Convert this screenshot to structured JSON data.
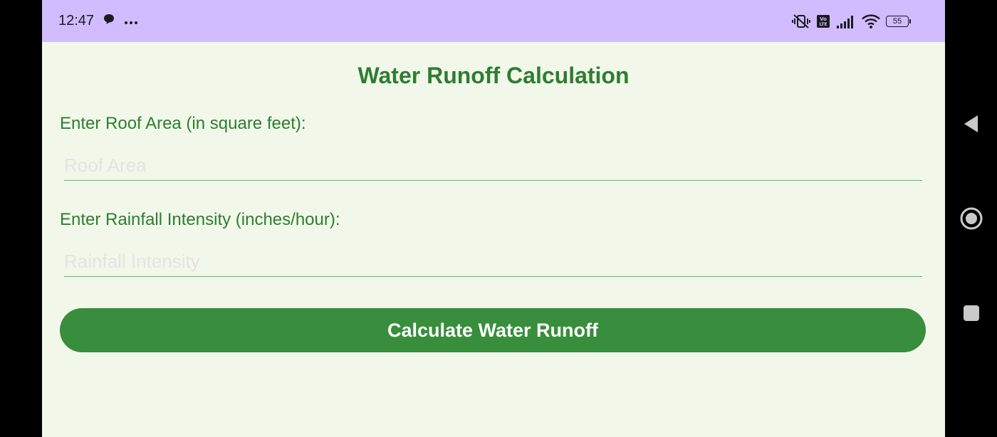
{
  "status_bar": {
    "time": "12:47",
    "icons": [
      "chat-bubble-icon",
      "more-dots-icon",
      "vibrate-off-icon",
      "volte-icon",
      "signal-icon",
      "wifi-icon",
      "battery-icon"
    ],
    "battery_level": "55",
    "volte_label_top": "Vo",
    "volte_label_bottom": "LTE"
  },
  "app": {
    "title": "Water Runoff Calculation",
    "roof_area": {
      "label": "Enter Roof Area (in square feet):",
      "placeholder": "Roof Area",
      "value": ""
    },
    "rainfall_intensity": {
      "label": "Enter Rainfall Intensity (inches/hour):",
      "placeholder": "Rainfall Intensity",
      "value": ""
    },
    "calculate_button": "Calculate Water Runoff"
  },
  "nav_bar": {
    "buttons": [
      "back-icon",
      "home-icon",
      "recents-icon"
    ]
  },
  "colors": {
    "status_bar": "#d0bcff",
    "background": "#f1f8e9",
    "primary_green": "#2e7d32",
    "button_green": "#388e3c",
    "underline": "#66bb6a"
  }
}
